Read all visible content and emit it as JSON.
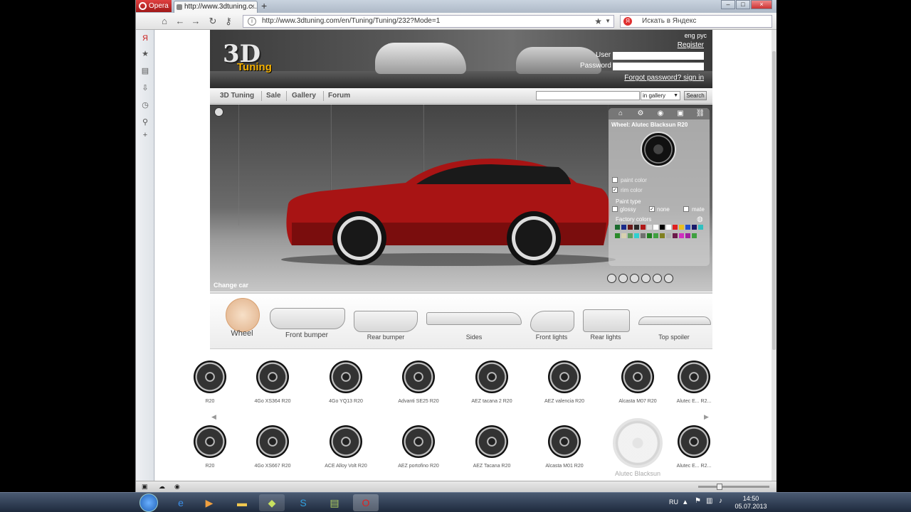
{
  "browser": {
    "menu_label": "Opera",
    "tab_title": "http://www.3dtuning.c...",
    "url": "http://www.3dtuning.com/en/Tuning/Tuning/232?Mode=1",
    "search_placeholder": "Искать в Яндекс"
  },
  "site": {
    "logo_3d": "3D",
    "logo_tuning": "Tuning",
    "lang": "eng рус",
    "register": "Register",
    "user_label": "User",
    "password_label": "Password",
    "forgot": "Forgot password?",
    "signin": "sign in",
    "nav": [
      "3D Tuning",
      "Sale",
      "Gallery",
      "Forum"
    ],
    "gallery_scope": "in gallery",
    "search_button": "Search",
    "change_car": "Change car",
    "panel": {
      "title": "Wheel: Alutec Blacksun R20",
      "paint_color": "paint color",
      "rim_color": "rim color",
      "paint_type": "Paint type",
      "glossy": "glossy",
      "none": "none",
      "mate": "mate",
      "factory_colors": "Factory colors",
      "swatches": [
        "#1a6a2e",
        "#1a2a8a",
        "#6a1a1a",
        "#2a2a2a",
        "#b01818",
        "#d8d8d8",
        "#ffffff",
        "#000000",
        "#ffffff",
        "#e02020",
        "#e8c020",
        "#2050d0",
        "#1a1a6a",
        "#30c0c0",
        "#2a8a2a",
        "#d8d0b0",
        "#60a060",
        "#30d0d0",
        "#707070",
        "#208020",
        "#40a040",
        "#808020",
        "#b0b0b0",
        "#6a1a4a",
        "#d030c0",
        "#a020a0",
        "#40a040"
      ]
    },
    "parts": [
      "Wheel",
      "Front bumper",
      "Rear bumper",
      "Sides",
      "Front lights",
      "Rear lights",
      "Top spoiler"
    ],
    "wheels_row1": [
      "R20",
      "4Go XS364 R20",
      "4Go YQ13 R20",
      "Advanti SE25 R20",
      "AEZ tacana 2 R20",
      "AEZ valencia R20",
      "Alcasta M07 R20",
      "Alutec E... R2..."
    ],
    "wheels_row2": [
      "R20",
      "4Go XS667 R20",
      "ACE Alloy Volt R20",
      "AEZ portofino R20",
      "AEZ Tacana R20",
      "Alcasta M01 R20",
      "Alutec Blacksun",
      "Alutec E... R2..."
    ]
  },
  "taskbar": {
    "lang": "RU",
    "time": "14:50",
    "date": "05.07.2013"
  }
}
